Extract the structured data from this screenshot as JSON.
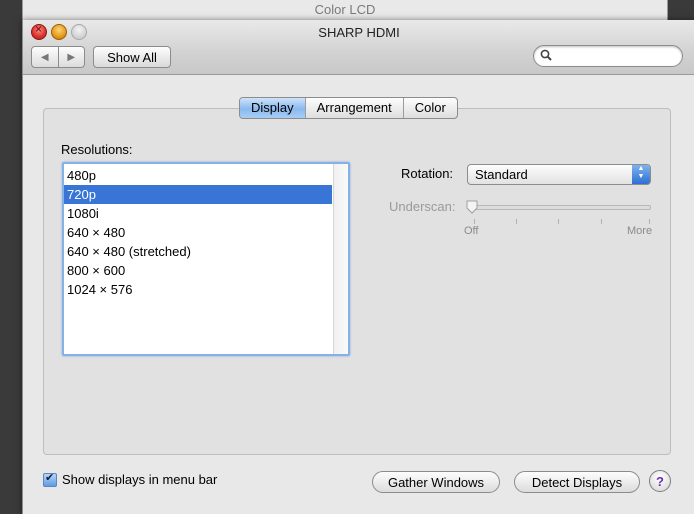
{
  "background_window": {
    "title": "Color LCD"
  },
  "window": {
    "title": "SHARP HDMI"
  },
  "toolbar": {
    "back_icon": "back-arrow-icon",
    "forward_icon": "forward-arrow-icon",
    "show_all_label": "Show All",
    "search_placeholder": "",
    "search_value": ""
  },
  "tabs": [
    {
      "label": "Display",
      "active": true
    },
    {
      "label": "Arrangement",
      "active": false
    },
    {
      "label": "Color",
      "active": false
    }
  ],
  "resolutions": {
    "label": "Resolutions:",
    "items": [
      "480p",
      "720p",
      "1080i",
      "640 × 480",
      "640 × 480 (stretched)",
      "800 × 600",
      "1024 × 576"
    ],
    "selected": "720p"
  },
  "rotation": {
    "label": "Rotation:",
    "value": "Standard"
  },
  "underscan": {
    "label": "Underscan:",
    "min_label": "Off",
    "max_label": "More",
    "level": 0,
    "enabled": false
  },
  "footer": {
    "show_in_menu_bar_label": "Show displays in menu bar",
    "show_in_menu_bar_checked": true,
    "gather_windows_label": "Gather Windows",
    "detect_displays_label": "Detect Displays",
    "help_label": "?"
  },
  "colors": {
    "accent": "#3875d7",
    "tab_active": "#8ab9ee",
    "help": "#6a2fb0"
  }
}
